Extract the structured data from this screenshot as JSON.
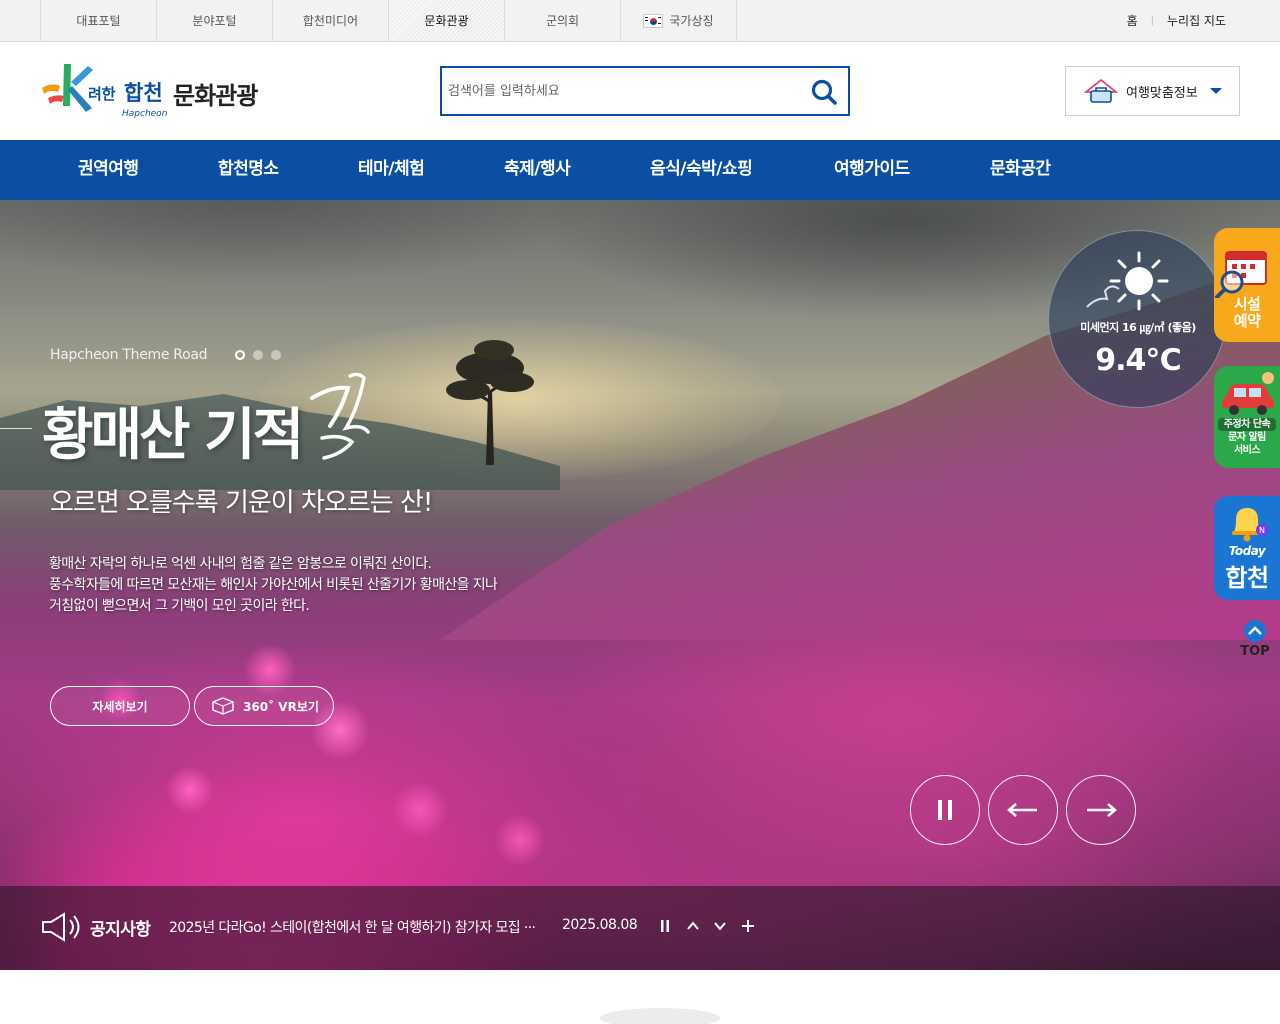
{
  "topbar": {
    "portals": [
      {
        "label": "대표포털",
        "active": false
      },
      {
        "label": "분야포털",
        "active": false
      },
      {
        "label": "합천미디어",
        "active": false
      },
      {
        "label": "문화관광",
        "active": true
      },
      {
        "label": "군의회",
        "active": false
      },
      {
        "label": "국가상징",
        "active": false,
        "icon": "korea-flag-icon"
      }
    ],
    "util": {
      "home": "홈",
      "sep": "|",
      "sitemap": "누리집 지도"
    }
  },
  "header": {
    "logo_text": "문화관광",
    "logo_sub": "Hapcheon",
    "logo_script": "기/려한 합천",
    "search_placeholder": "검색어를 입력하세요",
    "travel_button": "여행맞춤정보",
    "colors": {
      "brand_blue": "#0a4fa3"
    }
  },
  "gnb": {
    "items": [
      "권역여행",
      "합천명소",
      "테마/체험",
      "축제/행사",
      "음식/숙박/쇼핑",
      "여행가이드",
      "문화공간"
    ]
  },
  "hero": {
    "sub_en": "Hapcheon Theme Road",
    "title": "황매산 기적",
    "title_script": "길",
    "subtitle": "오르면 오를수록 기운이 차오르는 산!",
    "desc": [
      "황매산 자락의 하나로 억센 사내의 험줄 같은 암봉으로 이뤄진 산이다.",
      "풍수학자들에 따르면 모산재는 해인사 가야산에서 비롯된 산줄기가 황매산을 지나",
      "거침없이 뻗으면서 그 기백이 모인 곳이라 한다."
    ],
    "btn_detail": "자세히보기",
    "btn_vr": "360˚ VR보기",
    "slide_count": 3,
    "active_slide": 1
  },
  "weather": {
    "dust": "미세먼지 16 ㎍/㎥ (좋음)",
    "temp": "9.4℃",
    "icon": "sun-icon"
  },
  "quick": {
    "facility": "시설\n예약",
    "parking": [
      "주정차 단속",
      "문자 알림",
      "서비스"
    ],
    "today_en": "Today",
    "today_ko": "합천",
    "top": "TOP"
  },
  "notice": {
    "label": "공지사항",
    "text": "2025년 다라Go! 스테이(합천에서 한 달 여행하기) 참가자 모집 ···",
    "date": "2025.08.08"
  }
}
